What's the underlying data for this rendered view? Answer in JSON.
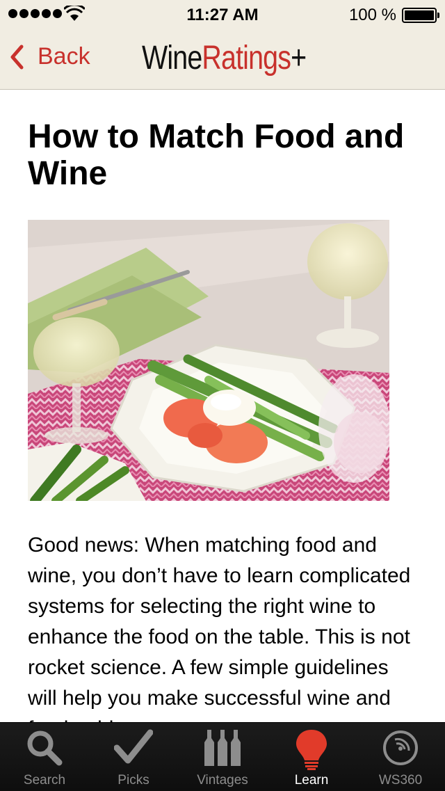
{
  "status_bar": {
    "time": "11:27 AM",
    "battery": "100 %",
    "signal_icon": "cellular-signal-icon",
    "wifi_icon": "wifi-icon",
    "battery_icon": "battery-icon"
  },
  "nav": {
    "back_label": "Back",
    "logo_wine": "Wine",
    "logo_ratings": "Ratings",
    "logo_plus": "+"
  },
  "article": {
    "title": "How to Match Food and Wine",
    "body": "Good news: When matching food and wine, you don’t have to learn complicated systems for selecting the right wine to enhance the food on the table. This is not rocket science. A few simple guidelines will help you make successful wine and food pairings."
  },
  "tabs": [
    {
      "label": "Search",
      "icon": "magnifier-icon"
    },
    {
      "label": "Picks",
      "icon": "checkmark-icon"
    },
    {
      "label": "Vintages",
      "icon": "wine-bottles-icon"
    },
    {
      "label": "Learn",
      "icon": "lightbulb-icon",
      "active": true
    },
    {
      "label": "WS360",
      "icon": "ws360-dial-icon"
    }
  ],
  "colors": {
    "accent": "#c8312c",
    "nav_background": "#f1ede2",
    "tab_background": "#141414"
  }
}
